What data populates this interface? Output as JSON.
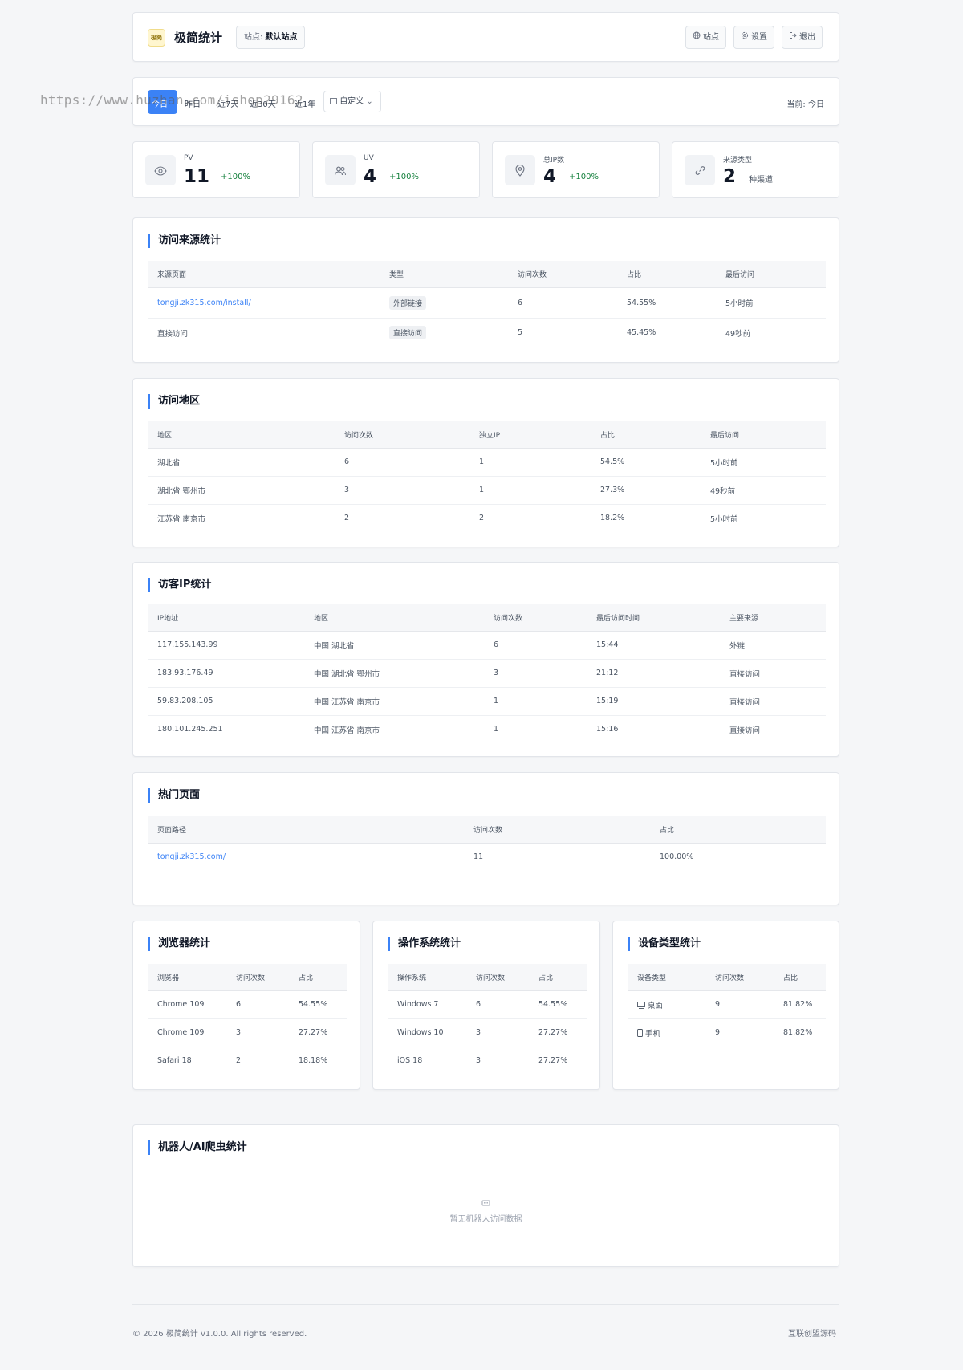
{
  "header": {
    "logo_text": "极简",
    "title": "极简统计",
    "site_label": "站点:",
    "site_name": "默认站点",
    "buttons": {
      "sites": "站点",
      "settings": "设置",
      "logout": "退出"
    }
  },
  "watermark": "https://www.huzhan.com/ishop29162",
  "range": {
    "tabs": [
      "今日",
      "昨日",
      "近7天",
      "近30天",
      "近1年"
    ],
    "custom_label": "自定义",
    "current": "当前: 今日"
  },
  "stats": [
    {
      "label": "PV",
      "value": "11",
      "change": "+100%"
    },
    {
      "label": "UV",
      "value": "4",
      "change": "+100%"
    },
    {
      "label": "总IP数",
      "value": "4",
      "change": "+100%"
    },
    {
      "label": "来源类型",
      "value": "2",
      "note": "种渠道"
    }
  ],
  "sources": {
    "title": "访问来源统计",
    "columns": [
      "来源页面",
      "类型",
      "访问次数",
      "占比",
      "最后访问"
    ],
    "rows": [
      [
        "tongji.zk315.com/install/",
        "外部链接",
        "6",
        "54.55%",
        "5小时前"
      ],
      [
        "直接访问",
        "直接访问",
        "5",
        "45.45%",
        "49秒前"
      ]
    ]
  },
  "regions": {
    "title": "访问地区",
    "columns": [
      "地区",
      "访问次数",
      "独立IP",
      "占比",
      "最后访问"
    ],
    "rows": [
      [
        "湖北省",
        "6",
        "1",
        "54.5%",
        "5小时前"
      ],
      [
        "湖北省 鄂州市",
        "3",
        "1",
        "27.3%",
        "49秒前"
      ],
      [
        "江苏省 南京市",
        "2",
        "2",
        "18.2%",
        "5小时前"
      ]
    ]
  },
  "ips": {
    "title": "访客IP统计",
    "columns": [
      "IP地址",
      "地区",
      "访问次数",
      "最后访问时间",
      "主要来源"
    ],
    "rows": [
      [
        "117.155.143.99",
        "中国 湖北省",
        "6",
        "15:44",
        "外链"
      ],
      [
        "183.93.176.49",
        "中国 湖北省 鄂州市",
        "3",
        "21:12",
        "直接访问"
      ],
      [
        "59.83.208.105",
        "中国 江苏省 南京市",
        "1",
        "15:19",
        "直接访问"
      ],
      [
        "180.101.245.251",
        "中国 江苏省 南京市",
        "1",
        "15:16",
        "直接访问"
      ]
    ]
  },
  "pages": {
    "title": "热门页面",
    "columns": [
      "页面路径",
      "访问次数",
      "占比"
    ],
    "rows": [
      [
        "tongji.zk315.com/",
        "11",
        "100.00%"
      ]
    ]
  },
  "browsers": {
    "title": "浏览器统计",
    "columns": [
      "浏览器",
      "访问次数",
      "占比"
    ],
    "rows": [
      [
        "Chrome 109",
        "6",
        "54.55%"
      ],
      [
        "Chrome 109",
        "3",
        "27.27%"
      ],
      [
        "Safari 18",
        "2",
        "18.18%"
      ]
    ]
  },
  "os": {
    "title": "操作系统统计",
    "columns": [
      "操作系统",
      "访问次数",
      "占比"
    ],
    "rows": [
      [
        "Windows 7",
        "6",
        "54.55%"
      ],
      [
        "Windows 10",
        "3",
        "27.27%"
      ],
      [
        "iOS 18",
        "3",
        "27.27%"
      ]
    ]
  },
  "devices": {
    "title": "设备类型统计",
    "columns": [
      "设备类型",
      "访问次数",
      "占比"
    ],
    "rows": [
      {
        "icon": "desktop-icon",
        "name": "桌面",
        "count": "9",
        "pct": "81.82%"
      },
      {
        "icon": "mobile-icon",
        "name": "手机",
        "count": "9",
        "pct": "81.82%"
      }
    ]
  },
  "bots": {
    "title": "机器人/AI爬虫统计",
    "empty_text": "暂无机器人访问数据"
  },
  "footer": {
    "copyright": "© 2026 极简统计 v1.0.0. All rights reserved.",
    "link": "互联创盟源码"
  },
  "colors": {
    "accent": "#3b82f6",
    "positive": "#15803d"
  }
}
